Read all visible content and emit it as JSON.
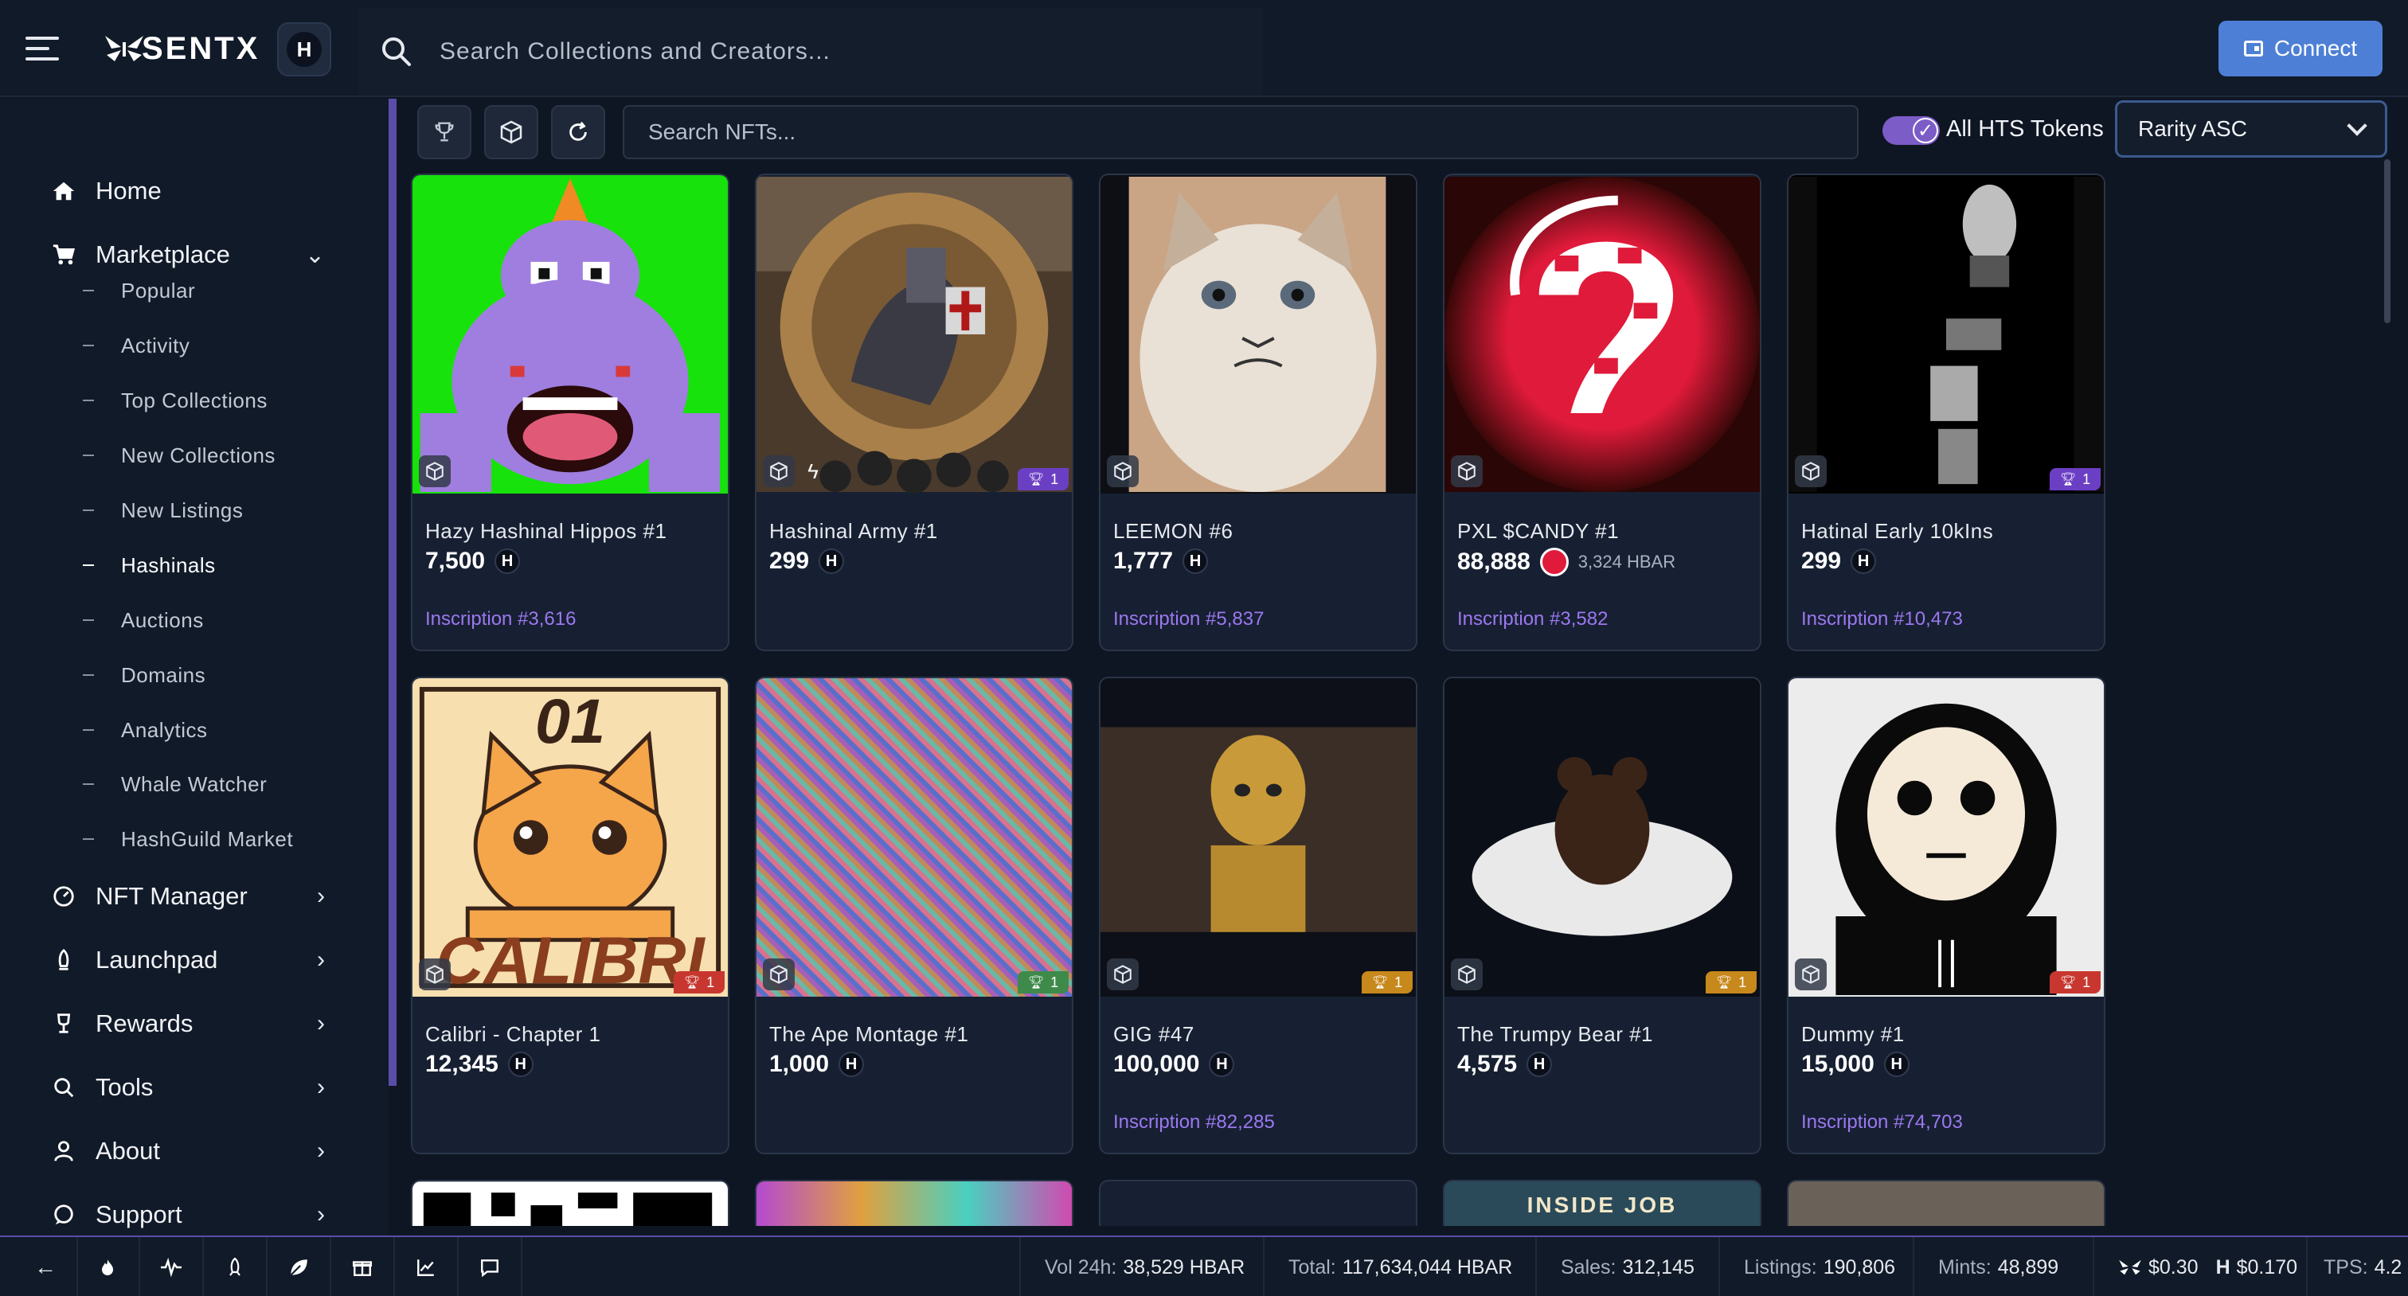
{
  "header": {
    "logo_text": "SENTX",
    "network_badge": "H",
    "search_placeholder": "Search Collections and Creators...",
    "connect_label": "Connect"
  },
  "sidebar": {
    "items": [
      {
        "label": "Home",
        "icon": "home-icon"
      },
      {
        "label": "Marketplace",
        "icon": "cart-icon",
        "chevron": "down"
      },
      {
        "label": "NFT Manager",
        "icon": "gauge-icon",
        "chevron": "right"
      },
      {
        "label": "Launchpad",
        "icon": "rocket-icon",
        "chevron": "right"
      },
      {
        "label": "Rewards",
        "icon": "trophy-icon",
        "chevron": "right"
      },
      {
        "label": "Tools",
        "icon": "search-icon",
        "chevron": "right"
      },
      {
        "label": "About",
        "icon": "person-icon",
        "chevron": "right"
      },
      {
        "label": "Support",
        "icon": "chat-icon",
        "chevron": "right"
      }
    ],
    "marketplace_sub": [
      "Popular",
      "Activity",
      "Top Collections",
      "New Collections",
      "New Listings",
      "Hashinals",
      "Auctions",
      "Domains",
      "Analytics",
      "Whale Watcher",
      "HashGuild Market"
    ],
    "active_sub": "Hashinals"
  },
  "toolbar": {
    "search_placeholder": "Search NFTs...",
    "toggle_label": "All HTS Tokens",
    "toggle_on": true,
    "sort_value": "Rarity ASC"
  },
  "cards": [
    {
      "name": "Hazy Hashinal Hippos #1",
      "price": "7,500",
      "inscription": "Inscription #3,616",
      "rank": ""
    },
    {
      "name": "Hashinal Army #1",
      "price": "299",
      "inscription": "",
      "rank": "1",
      "rank_color": "#6b3fc4"
    },
    {
      "name": "LEEMON #6",
      "price": "1,777",
      "inscription": "Inscription #5,837",
      "rank": ""
    },
    {
      "name": "PXL $CANDY #1",
      "price": "88,888",
      "alt_price": "3,324",
      "alt_unit": "HBAR",
      "inscription": "Inscription #3,582",
      "rank": ""
    },
    {
      "name": "Hatinal Early 10kIns",
      "price": "299",
      "inscription": "Inscription #10,473",
      "rank": "1",
      "rank_color": "#6b3fc4"
    },
    {
      "name": "Calibri - Chapter 1",
      "price": "12,345",
      "inscription": "",
      "rank": "1",
      "rank_color": "#c8372f"
    },
    {
      "name": "The Ape Montage #1",
      "price": "1,000",
      "inscription": "",
      "rank": "1",
      "rank_color": "#3e8a4a"
    },
    {
      "name": "GIG #47",
      "price": "100,000",
      "inscription": "Inscription #82,285",
      "rank": "1",
      "rank_color": "#c7881c"
    },
    {
      "name": "The Trumpy Bear #1",
      "price": "4,575",
      "inscription": "",
      "rank": "1",
      "rank_color": "#c7881c"
    },
    {
      "name": "Dummy #1",
      "price": "15,000",
      "inscription": "Inscription #74,703",
      "rank": "1",
      "rank_color": "#c8372f"
    }
  ],
  "image_texts": {
    "calibri_top": "01",
    "calibri_bottom": "CALIBRI",
    "inside_job": "INSIDE JOB"
  },
  "footer": {
    "vol_label": "Vol 24h:",
    "vol_value": "38,529 HBAR",
    "total_label": "Total:",
    "total_value": "117,634,044 HBAR",
    "sales_label": "Sales:",
    "sales_value": "312,145",
    "listings_label": "Listings:",
    "listings_value": "190,806",
    "mints_label": "Mints:",
    "mints_value": "48,899",
    "sentx_price": "$0.30",
    "hbar_price": "$0.170",
    "tps_label": "TPS:",
    "tps_value": "4.2"
  },
  "colors": {
    "accent_purple": "#9b78f0",
    "connect_blue": "#4d7fd6",
    "background": "#0f1623",
    "card_bg": "#172032"
  }
}
